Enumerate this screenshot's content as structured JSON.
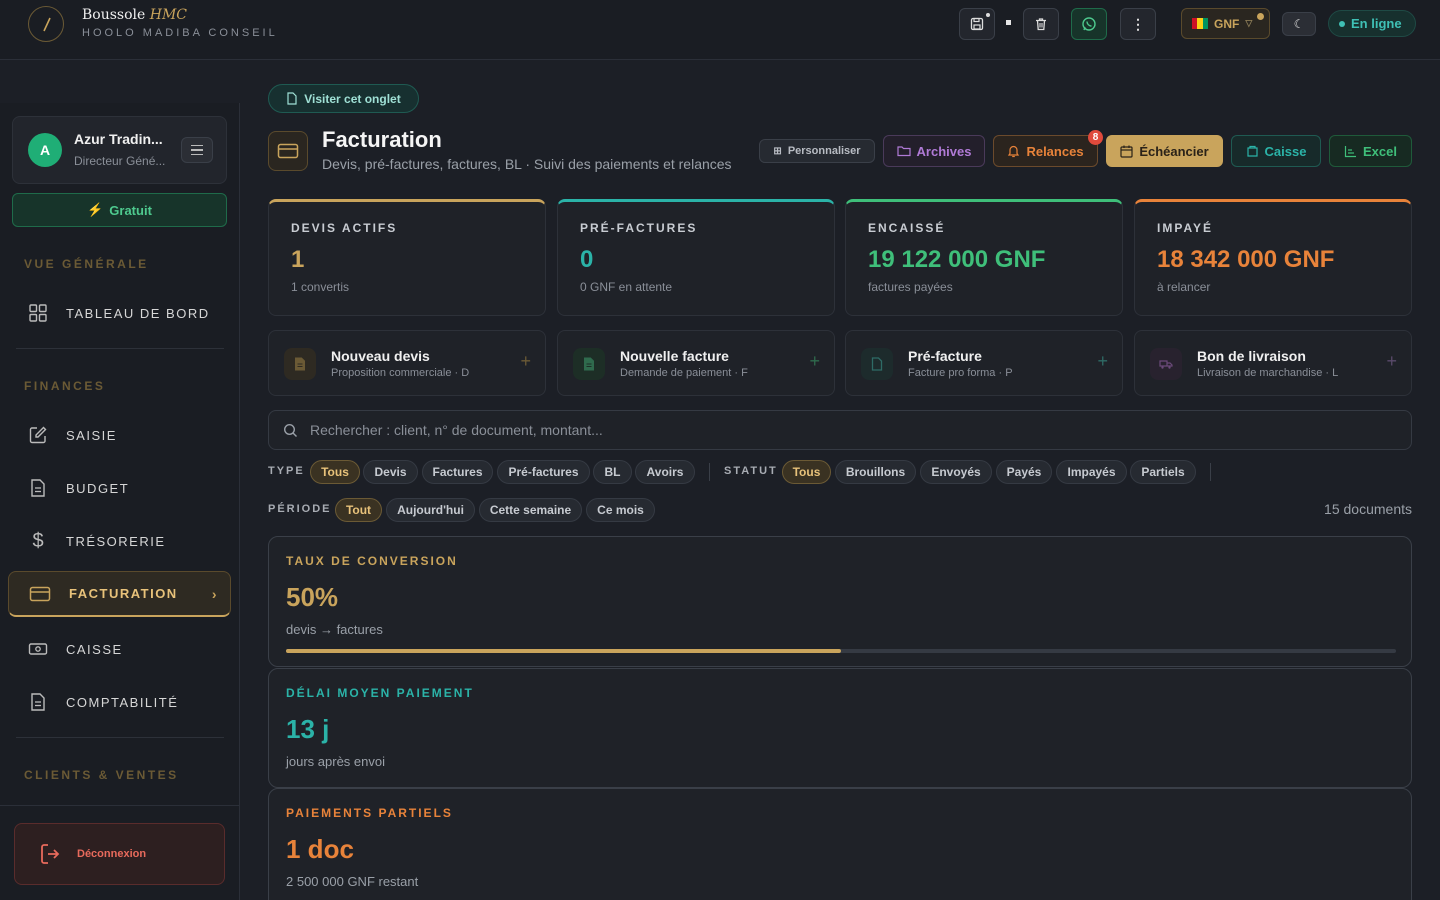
{
  "brand": {
    "name": "Boussole",
    "name_accent": "HMC",
    "subtitle": "HOOLO MADIBA CONSEIL"
  },
  "topbar": {
    "currency": "GNF",
    "status": "En ligne",
    "icons": [
      "save-icon",
      "trash-icon",
      "whatsapp-icon",
      "more-vertical-icon",
      "moon-icon"
    ]
  },
  "user": {
    "initial": "A",
    "name": "Azur Tradin...",
    "role": "Directeur Géné..."
  },
  "plan_label": "Gratuit",
  "sidebar": {
    "sections": {
      "overview": "VUE GÉNÉRALE",
      "finances": "FINANCES",
      "clients": "CLIENTS & VENTES"
    },
    "items": {
      "dashboard": "TABLEAU DE BORD",
      "saisie": "SAISIE",
      "budget": "BUDGET",
      "tresorerie": "TRÉSORERIE",
      "facturation": "FACTURATION",
      "caisse": "CAISSE",
      "comptabilite": "COMPTABILITÉ"
    },
    "logout": "Déconnexion"
  },
  "visit_tab": "Visiter cet onglet",
  "page": {
    "title": "Facturation",
    "subtitle": "Devis, pré-factures, factures, BL · Suivi des paiements et relances"
  },
  "header_buttons": {
    "customize": "Personnaliser",
    "archives": "Archives",
    "relances": "Relances",
    "relances_badge": "8",
    "echeancier": "Échéancier",
    "caisse": "Caisse",
    "excel": "Excel"
  },
  "kpis": [
    {
      "label": "DEVIS ACTIFS",
      "value": "1",
      "sub": "1 convertis",
      "color": "#c9a45c"
    },
    {
      "label": "PRÉ-FACTURES",
      "value": "0",
      "sub": "0 GNF en attente",
      "color": "#2bb3a8"
    },
    {
      "label": "ENCAISSÉ",
      "value": "19 122 000 GNF",
      "sub": "factures payées",
      "color": "#3fbf7a"
    },
    {
      "label": "IMPAYÉ",
      "value": "18 342 000 GNF",
      "sub": "à relancer",
      "color": "#e8833a"
    }
  ],
  "actions": [
    {
      "title": "Nouveau devis",
      "sub": "Proposition commerciale · D"
    },
    {
      "title": "Nouvelle facture",
      "sub": "Demande de paiement · F"
    },
    {
      "title": "Pré-facture",
      "sub": "Facture pro forma · P"
    },
    {
      "title": "Bon de livraison",
      "sub": "Livraison de marchandise · L"
    }
  ],
  "search": {
    "placeholder": "Rechercher : client, n° de document, montant..."
  },
  "filters": {
    "type_label": "TYPE",
    "type_options": [
      "Tous",
      "Devis",
      "Factures",
      "Pré-factures",
      "BL",
      "Avoirs"
    ],
    "type_selected": "Tous",
    "status_label": "STATUT",
    "status_options": [
      "Tous",
      "Brouillons",
      "Envoyés",
      "Payés",
      "Impayés",
      "Partiels"
    ],
    "status_selected": "Tous",
    "period_label": "PÉRIODE",
    "period_options": [
      "Tout",
      "Aujourd'hui",
      "Cette semaine",
      "Ce mois"
    ],
    "period_selected": "Tout"
  },
  "document_count": "15 documents",
  "stats": {
    "conversion": {
      "label": "TAUX DE CONVERSION",
      "value": "50%",
      "sub": "devis → factures",
      "progress": 0.5
    },
    "delay": {
      "label": "DÉLAI MOYEN PAIEMENT",
      "value": "13 j",
      "sub": "jours après envoi"
    },
    "partial": {
      "label": "PAIEMENTS PARTIELS",
      "value": "1 doc",
      "sub": "2 500 000 GNF restant"
    }
  },
  "colors": {
    "gold": "#c9a45c",
    "teal": "#2bb3a8",
    "green": "#3fbf7a",
    "orange": "#e8833a",
    "purple": "#b07ad6",
    "red": "#e04a3c"
  }
}
